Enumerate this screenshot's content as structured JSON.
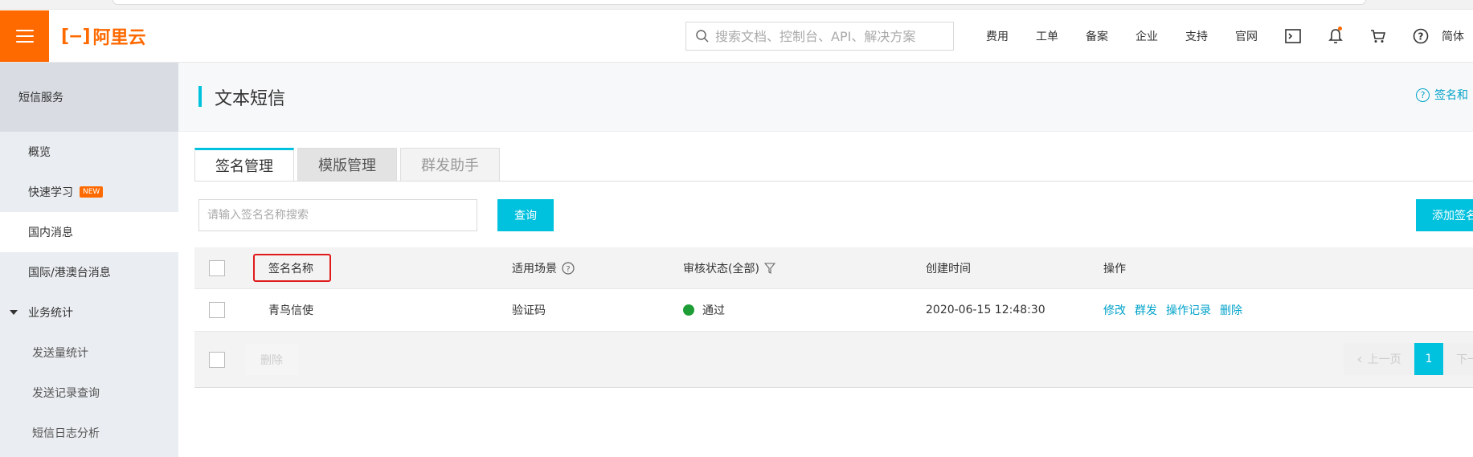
{
  "header": {
    "logo_text": "阿里云",
    "search_placeholder": "搜索文档、控制台、API、解决方案",
    "nav": [
      "费用",
      "工单",
      "备案",
      "企业",
      "支持",
      "官网"
    ],
    "lang": "简体",
    "icons": [
      "terminal-icon",
      "bell-icon",
      "cart-icon",
      "help-icon"
    ],
    "accent": "#ff6a00"
  },
  "sidebar": {
    "title": "短信服务",
    "items": [
      {
        "label": "概览"
      },
      {
        "label": "快速学习",
        "badge": "NEW"
      },
      {
        "label": "国内消息",
        "active": true
      },
      {
        "label": "国际/港澳台消息"
      },
      {
        "label": "业务统计",
        "expanded": true
      },
      {
        "label": "发送量统计",
        "sub": true
      },
      {
        "label": "发送记录查询",
        "sub": true
      },
      {
        "label": "短信日志分析",
        "sub": true
      }
    ]
  },
  "page": {
    "title": "文本短信",
    "help_text": "签名和"
  },
  "tabs": [
    "签名管理",
    "模版管理",
    "群发助手"
  ],
  "filter": {
    "placeholder": "请输入签名名称搜索",
    "query_label": "查询",
    "add_label": "添加签名"
  },
  "table": {
    "headers": {
      "name": "签名名称",
      "scene": "适用场景",
      "status": "审核状态(全部)",
      "created": "创建时间",
      "actions": "操作"
    },
    "rows": [
      {
        "name": "青鸟信使",
        "scene": "验证码",
        "status": "通过",
        "status_color": "#1e9d36",
        "created": "2020-06-15 12:48:30",
        "actions": [
          "修改",
          "群发",
          "操作记录",
          "删除"
        ]
      }
    ],
    "footer": {
      "delete_label": "删除",
      "prev_label": "上一页",
      "current_page": "1",
      "next_label": "下一页"
    }
  }
}
